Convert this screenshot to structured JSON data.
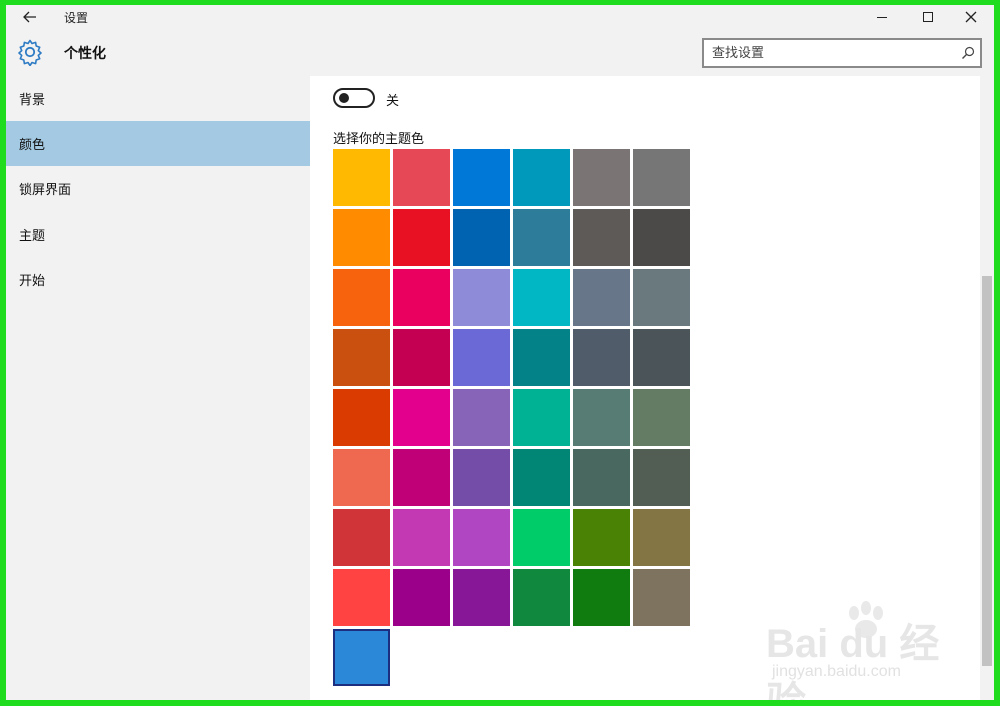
{
  "window": {
    "title": "设置",
    "back_icon": "arrow-left-icon",
    "minimize_icon": "minimize-icon",
    "maximize_icon": "maximize-icon",
    "close_icon": "close-icon"
  },
  "header": {
    "icon": "gear-icon",
    "title": "个性化",
    "search_placeholder": "查找设置",
    "search_icon": "search-icon"
  },
  "sidebar": {
    "items": [
      {
        "label": "背景",
        "active": false
      },
      {
        "label": "颜色",
        "active": true
      },
      {
        "label": "锁屏界面",
        "active": false
      },
      {
        "label": "主题",
        "active": false
      },
      {
        "label": "开始",
        "active": false
      }
    ]
  },
  "main": {
    "toggle": {
      "state_label": "关",
      "on": false
    },
    "section_label": "选择你的主题色",
    "swatches": [
      [
        "#ffb900",
        "#e74856",
        "#0078d7",
        "#0099bc",
        "#7a7574",
        "#767676"
      ],
      [
        "#ff8c00",
        "#e81123",
        "#0063b1",
        "#2d7d9a",
        "#5d5a58",
        "#4c4a48"
      ],
      [
        "#f7630c",
        "#ea005e",
        "#8e8cd8",
        "#00b7c3",
        "#68768a",
        "#69797e"
      ],
      [
        "#ca5010",
        "#c30052",
        "#6b69d6",
        "#038387",
        "#515c6b",
        "#4a5459"
      ],
      [
        "#da3b01",
        "#e3008c",
        "#8764b8",
        "#00b294",
        "#567c73",
        "#647c64"
      ],
      [
        "#ef6950",
        "#bf0077",
        "#744da9",
        "#018574",
        "#486860",
        "#525e54"
      ],
      [
        "#d13438",
        "#c239b3",
        "#b146c2",
        "#00cc6a",
        "#498205",
        "#847545"
      ],
      [
        "#ff4343",
        "#9a0089",
        "#881798",
        "#10893e",
        "#107c10",
        "#7e735f"
      ],
      [
        "#2b88d8"
      ]
    ],
    "selected_swatch": "#2b88d8"
  },
  "watermark": {
    "logo": "Bai du 经验",
    "url": "jingyan.baidu.com"
  }
}
